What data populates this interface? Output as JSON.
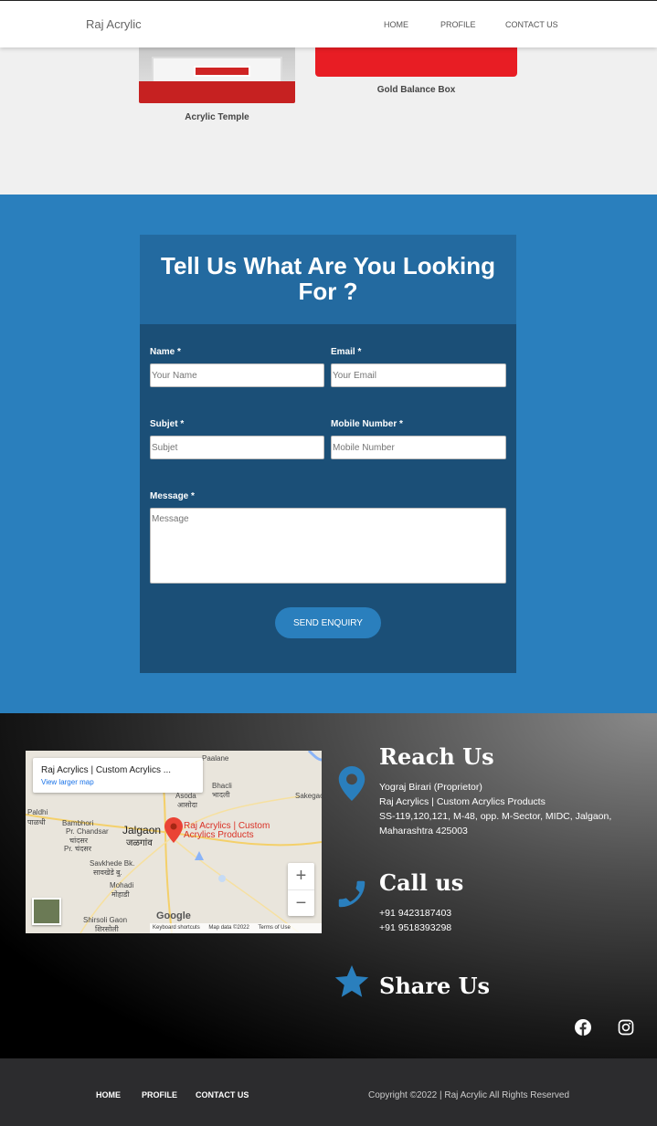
{
  "nav": {
    "brand": "Raj Acrylic",
    "links": [
      "HOME",
      "PROFILE",
      "CONTACT US"
    ]
  },
  "products": [
    {
      "title": "Acrylic Temple"
    },
    {
      "title": "Gold Balance Box"
    }
  ],
  "enquiry": {
    "title": "Tell Us What Are You Looking For ?",
    "name_label": "Name *",
    "name_placeholder": "Your Name",
    "email_label": "Email *",
    "email_placeholder": "Your Email",
    "subject_label": "Subjet *",
    "subject_placeholder": "Subjet",
    "mobile_label": "Mobile Number *",
    "mobile_placeholder": "Mobile Number",
    "message_label": "Message *",
    "message_placeholder": "Message",
    "submit_label": "SEND ENQUIRY"
  },
  "map": {
    "card_title": "Raj Acrylics | Custom Acrylics ...",
    "card_link": "View larger map",
    "pin_label_1": "Raj Acrylics | Custom",
    "pin_label_2": "Acrylics Products",
    "zoom_in": "+",
    "zoom_out": "−",
    "logo": "Google",
    "footer_shortcuts": "Keyboard shortcuts",
    "footer_data": "Map data ©2022",
    "footer_terms": "Terms of Use",
    "places": [
      "Paldhi",
      "पाळधी",
      "Bambhori",
      "Pr. Chandsar",
      "चांदसर",
      "Pr. चंदसर",
      "Jalgaon",
      "जळगांव",
      "Savkhede Bk.",
      "सावखेडे बु.",
      "Mohadi",
      "मोहाडी",
      "Shirsoli Gaon",
      "शिरसोली",
      "Bhacli",
      "भादली",
      "Sakegaon",
      "Paalane",
      "Asoda",
      "आसोदा"
    ]
  },
  "reach": {
    "heading": "Reach Us",
    "lines": [
      "Yograj Birari (Proprietor)",
      "Raj Acrylics | Custom Acrylics Products",
      "SS-119,120,121, M-48, opp. M-Sector, MIDC, Jalgaon,",
      "Maharashtra 425003"
    ]
  },
  "call": {
    "heading": "Call us",
    "phones": [
      "+91 9423187403",
      "+91 9518393298"
    ]
  },
  "share": {
    "heading": "Share Us",
    "icons": [
      "facebook-icon",
      "instagram-icon"
    ]
  },
  "footer": {
    "links": [
      "HOME",
      "PROFILE",
      "CONTACT US"
    ],
    "copyright": "Copyright ©2022 | Raj Acrylic All Rights Reserved"
  },
  "colors": {
    "accent": "#2a7fbd",
    "card_dark": "#1b4f77",
    "card_head": "#236aa0",
    "footer_bg": "#2c2c2e"
  }
}
